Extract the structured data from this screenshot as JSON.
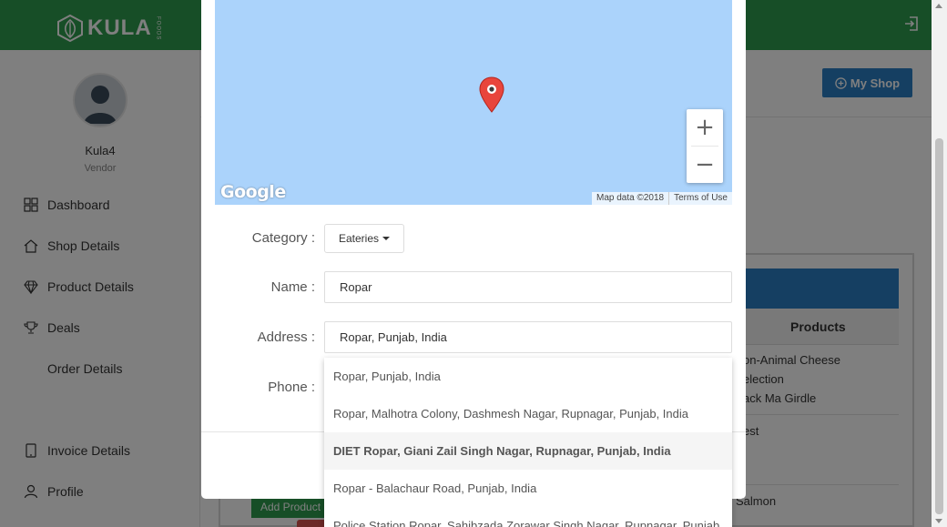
{
  "brand": {
    "name": "KULA",
    "sub": "FOODS"
  },
  "user": {
    "name": "Kula4",
    "role": "Vendor"
  },
  "sidebar": {
    "items": [
      {
        "label": "Dashboard",
        "icon": "grid-icon"
      },
      {
        "label": "Shop Details",
        "icon": "home-icon"
      },
      {
        "label": "Product Details",
        "icon": "diamond-icon"
      },
      {
        "label": "Deals",
        "icon": "trophy-icon"
      },
      {
        "label": "Order Details",
        "icon": ""
      },
      {
        "label": "Invoice Details",
        "icon": "tablet-icon"
      },
      {
        "label": "Profile",
        "icon": "user-icon"
      }
    ]
  },
  "header": {
    "my_shop_label": "My Shop"
  },
  "table": {
    "products_header": "Products",
    "rows": [
      [
        "on-Animal Cheese",
        "election",
        "ack Ma Girdle"
      ],
      [
        "est"
      ],
      [
        "Salmon"
      ]
    ],
    "add_product_label": "Add Product"
  },
  "modal": {
    "map": {
      "google_label": "Google",
      "map_data": "Map data ©2018",
      "terms": "Terms of Use",
      "zoom_in": "+",
      "zoom_out": "−"
    },
    "labels": {
      "category": "Category :",
      "name": "Name :",
      "address": "Address :",
      "phone": "Phone :"
    },
    "category_value": "Eateries",
    "name_value": "Ropar",
    "address_value": "Ropar, Punjab, India"
  },
  "suggestions": [
    "Ropar, Punjab, India",
    "Ropar, Malhotra Colony, Dashmesh Nagar, Rupnagar, Punjab, India",
    "DIET Ropar, Giani Zail Singh Nagar, Rupnagar, Punjab, India",
    "Ropar - Balachaur Road, Punjab, India",
    "Police Station Ropar, Sahibzada Zorawar Singh Nagar, Rupnagar, Punjab"
  ],
  "colors": {
    "brand_green": "#2e9c4e",
    "accent_blue": "#2a7fc5",
    "map_water": "#abd3fb",
    "pin_red": "#e8453c"
  }
}
